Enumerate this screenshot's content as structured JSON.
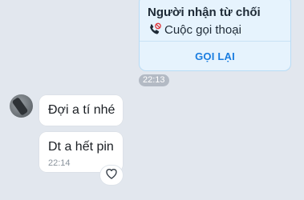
{
  "call_card": {
    "title": "Người nhận từ chối",
    "subtitle": "Cuộc gọi thoại",
    "callback_label": "GỌI LẠI",
    "time": "22:13"
  },
  "messages": [
    {
      "text": "Đợi a tí nhé"
    },
    {
      "text": "Dt a hết pin",
      "time": "22:14"
    }
  ],
  "colors": {
    "background": "#e2e7ee",
    "call_card_bg": "#e6f3fd",
    "accent": "#1a7de0",
    "missed_red": "#e0393e"
  },
  "icons": {
    "call_status": "declined-call-icon",
    "reaction": "heart-icon"
  }
}
